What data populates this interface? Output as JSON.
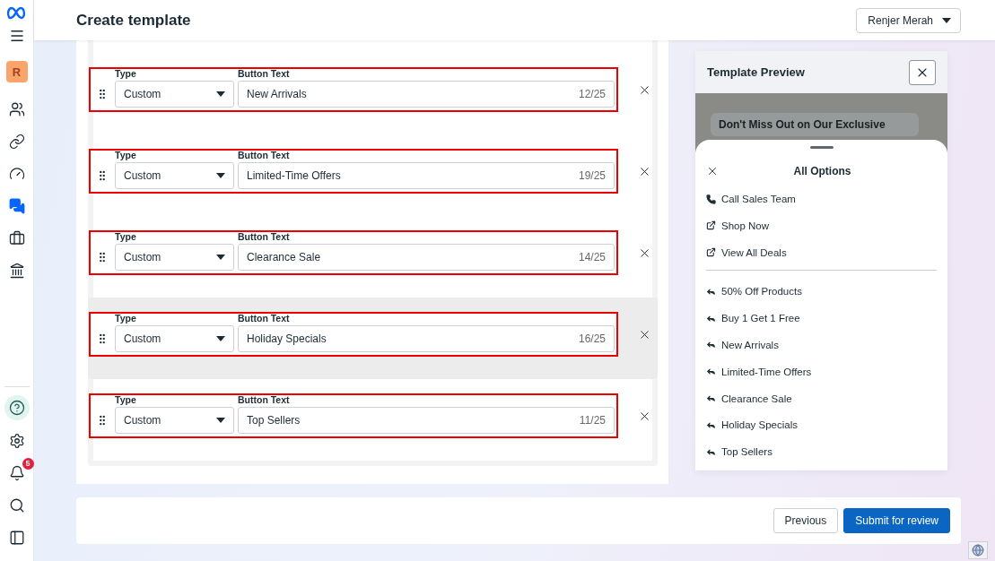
{
  "sidebar": {
    "avatar": "R",
    "items": [
      {
        "kind": "people",
        "selected": false
      },
      {
        "kind": "link",
        "selected": false
      },
      {
        "kind": "gauge",
        "selected": false
      },
      {
        "kind": "chat",
        "selected": true
      },
      {
        "kind": "briefcase",
        "selected": false
      },
      {
        "kind": "bank",
        "selected": false
      }
    ],
    "bottom_items": [
      {
        "kind": "help",
        "selected": false
      },
      {
        "kind": "settings",
        "selected": false
      },
      {
        "kind": "bell",
        "selected": false,
        "badge": "5"
      },
      {
        "kind": "search",
        "selected": false
      },
      {
        "kind": "panel",
        "selected": false
      }
    ]
  },
  "header": {
    "title": "Create template",
    "account": "Renjer Merah"
  },
  "buttons_editor": {
    "rows": [
      {
        "type_label": "Type",
        "type_value": "Custom",
        "text_label": "Button Text",
        "text_value": "New Arrivals",
        "counter": "12/25",
        "highlighted": true,
        "dragging": false
      },
      {
        "type_label": "Type",
        "type_value": "Custom",
        "text_label": "Button Text",
        "text_value": "Limited-Time Offers",
        "counter": "19/25",
        "highlighted": true,
        "dragging": false
      },
      {
        "type_label": "Type",
        "type_value": "Custom",
        "text_label": "Button Text",
        "text_value": "Clearance Sale",
        "counter": "14/25",
        "highlighted": true,
        "dragging": false
      },
      {
        "type_label": "Type",
        "type_value": "Custom",
        "text_label": "Button Text",
        "text_value": "Holiday Specials",
        "counter": "16/25",
        "highlighted": true,
        "dragging": true
      },
      {
        "type_label": "Type",
        "type_value": "Custom",
        "text_label": "Button Text",
        "text_value": "Top Sellers",
        "counter": "11/25",
        "highlighted": true,
        "dragging": false
      }
    ]
  },
  "preview": {
    "title": "Template Preview",
    "message": "Don't Miss Out on Our Exclusive",
    "sheet_title": "All Options",
    "options": [
      {
        "kind": "call",
        "label": "Call Sales Team"
      },
      {
        "kind": "url",
        "label": "Shop Now"
      },
      {
        "kind": "url",
        "label": "View All Deals"
      },
      {
        "kind": "quick_reply",
        "label": "50% Off Products"
      },
      {
        "kind": "quick_reply",
        "label": "Buy 1 Get 1 Free"
      },
      {
        "kind": "quick_reply",
        "label": "New Arrivals"
      },
      {
        "kind": "quick_reply",
        "label": "Limited-Time Offers"
      },
      {
        "kind": "quick_reply",
        "label": "Clearance Sale"
      },
      {
        "kind": "quick_reply",
        "label": "Holiday Specials"
      },
      {
        "kind": "quick_reply",
        "label": "Top Sellers"
      }
    ]
  },
  "footer": {
    "buttons": [
      {
        "kind": "secondary",
        "label": "Previous"
      },
      {
        "kind": "primary",
        "label": "Submit for review"
      }
    ]
  }
}
